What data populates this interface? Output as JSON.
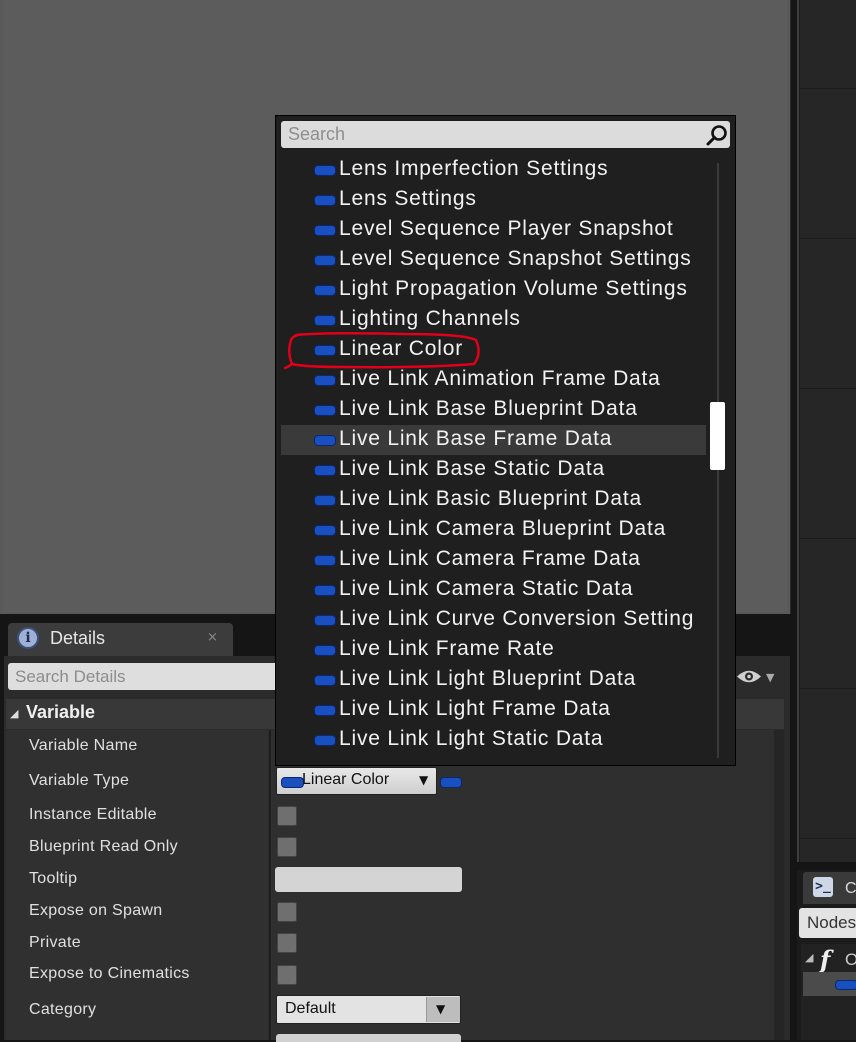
{
  "popup": {
    "search_placeholder": "Search",
    "items": [
      "Lens Imperfection Settings",
      "Lens Settings",
      "Level Sequence Player Snapshot",
      "Level Sequence Snapshot Settings",
      "Light Propagation Volume Settings",
      "Lighting Channels",
      "Linear Color",
      "Live Link Animation Frame Data",
      "Live Link Base Blueprint Data",
      "Live Link Base Frame Data",
      "Live Link Base Static Data",
      "Live Link Basic Blueprint Data",
      "Live Link Camera Blueprint Data",
      "Live Link Camera Frame Data",
      "Live Link Camera Static Data",
      "Live Link Curve Conversion Setting",
      "Live Link Frame Rate",
      "Live Link Light Blueprint Data",
      "Live Link Light Frame Data",
      "Live Link Light Static Data"
    ],
    "hovered_item": "Live Link Base Frame Data",
    "annotated_item": "Linear Color",
    "annotation_color": "#e0001a",
    "pin_color": "#1a4fbf"
  },
  "details": {
    "tab_label": "Details",
    "close": "×",
    "search_placeholder": "Search Details",
    "section": "Variable",
    "properties": {
      "variable_name": "Variable Name",
      "variable_type": "Variable Type",
      "instance_editable": "Instance Editable",
      "blueprint_read_only": "Blueprint Read Only",
      "tooltip": "Tooltip",
      "expose_on_spawn": "Expose on Spawn",
      "private": "Private",
      "expose_to_cinematics": "Expose to Cinematics",
      "category": "Category"
    },
    "variable_type_value": "Linear Color",
    "category_value": "Default"
  },
  "right_panel": {
    "tab_icon_glyph": ">_",
    "tab_label": "C",
    "search_value": "Nodes",
    "tree_glyph": "f",
    "tree_item": "O"
  }
}
